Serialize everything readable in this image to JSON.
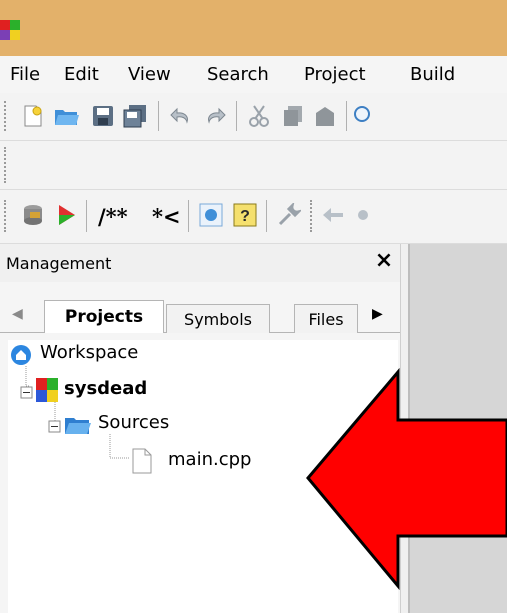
{
  "menu": [
    "File",
    "Edit",
    "View",
    "Search",
    "Project",
    "Build"
  ],
  "toolbar2": {
    "doc_comment_label": "/**",
    "comment_label": "*<"
  },
  "panel": {
    "title": "Management",
    "close_glyph": "×"
  },
  "tabs": [
    {
      "label": "Projects",
      "active": true
    },
    {
      "label": "Symbols",
      "active": false
    },
    {
      "label": "Files",
      "active": false
    }
  ],
  "tab_nav": {
    "left": "◀",
    "right": "▶"
  },
  "tree": {
    "workspace": "Workspace",
    "project": "sysdead",
    "folder": "Sources",
    "file": "main.cpp"
  },
  "colors": {
    "titlebar": "#e3b16a",
    "arrow_fill": "#ff0000",
    "arrow_stroke": "#000000"
  }
}
